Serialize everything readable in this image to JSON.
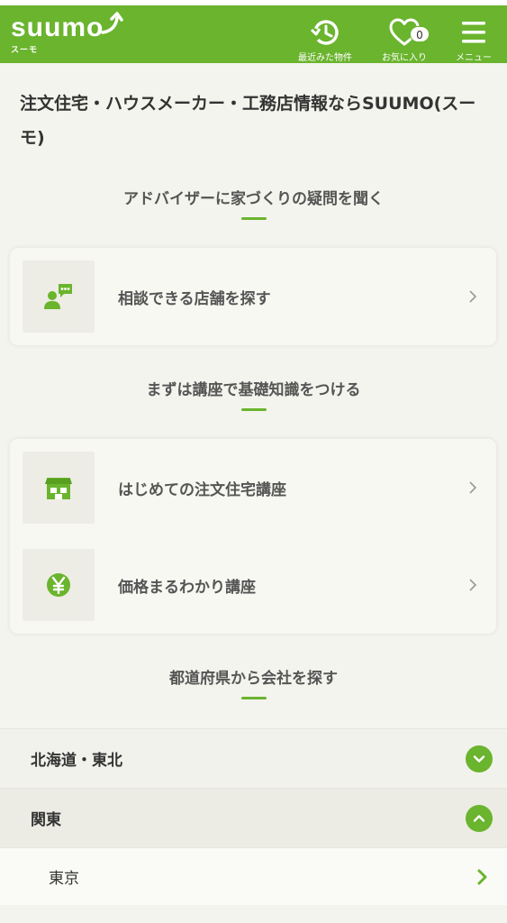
{
  "header": {
    "logo_text": "suumo",
    "logo_sub": "スーモ",
    "history_label": "最近みた物件",
    "favorites_label": "お気に入り",
    "favorites_count": "0",
    "menu_label": "メニュー",
    "brand_color": "#6ab42e"
  },
  "page": {
    "title": "注文住宅・ハウスメーカー・工務店情報ならSUUMO(スーモ)"
  },
  "advisor": {
    "title": "アドバイザーに家づくりの疑問を聞く",
    "items": [
      {
        "label": "相談できる店舗を探す",
        "icon": "consultation-icon"
      }
    ]
  },
  "course": {
    "title": "まずは講座で基礎知識をつける",
    "items": [
      {
        "label": "はじめての注文住宅講座",
        "icon": "house-icon"
      },
      {
        "label": "価格まるわかり講座",
        "icon": "yen-icon"
      }
    ]
  },
  "region": {
    "title": "都道府県から会社を探す",
    "areas": [
      {
        "label": "北海道・東北",
        "state": "collapsed"
      },
      {
        "label": "関東",
        "state": "expanded"
      }
    ],
    "prefectures": [
      {
        "label": "東京"
      }
    ]
  }
}
